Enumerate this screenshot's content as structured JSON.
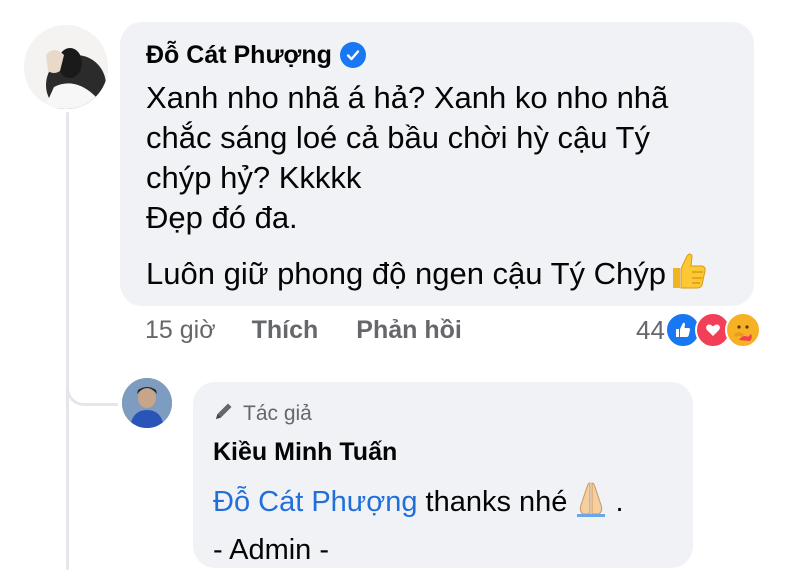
{
  "comment": {
    "author": "Đỗ Cát Phượng",
    "lines": [
      "Xanh nho nhã á hả? Xanh ko nho nhã",
      "chắc sáng loé cả bầu chời hỳ  cậu Tý",
      "chýp hỷ? Kkkkk",
      "Đẹp đó đa."
    ],
    "last_line": "Luôn giữ phong độ ngen cậu Tý Chýp",
    "time": "15 giờ",
    "like_label": "Thích",
    "reply_label": "Phản hồi",
    "reaction_count": "44",
    "colors": {
      "like": "#1877f2",
      "love": "#f33e58",
      "care": "#f7b125",
      "mention": "#216fdb"
    }
  },
  "reply": {
    "badge": "Tác giả",
    "author": "Kiều Minh Tuấn",
    "mention": "Đỗ Cát Phượng",
    "text_after_mention": "thanks nhé",
    "text_end": ".",
    "signature": "- Admin -"
  }
}
